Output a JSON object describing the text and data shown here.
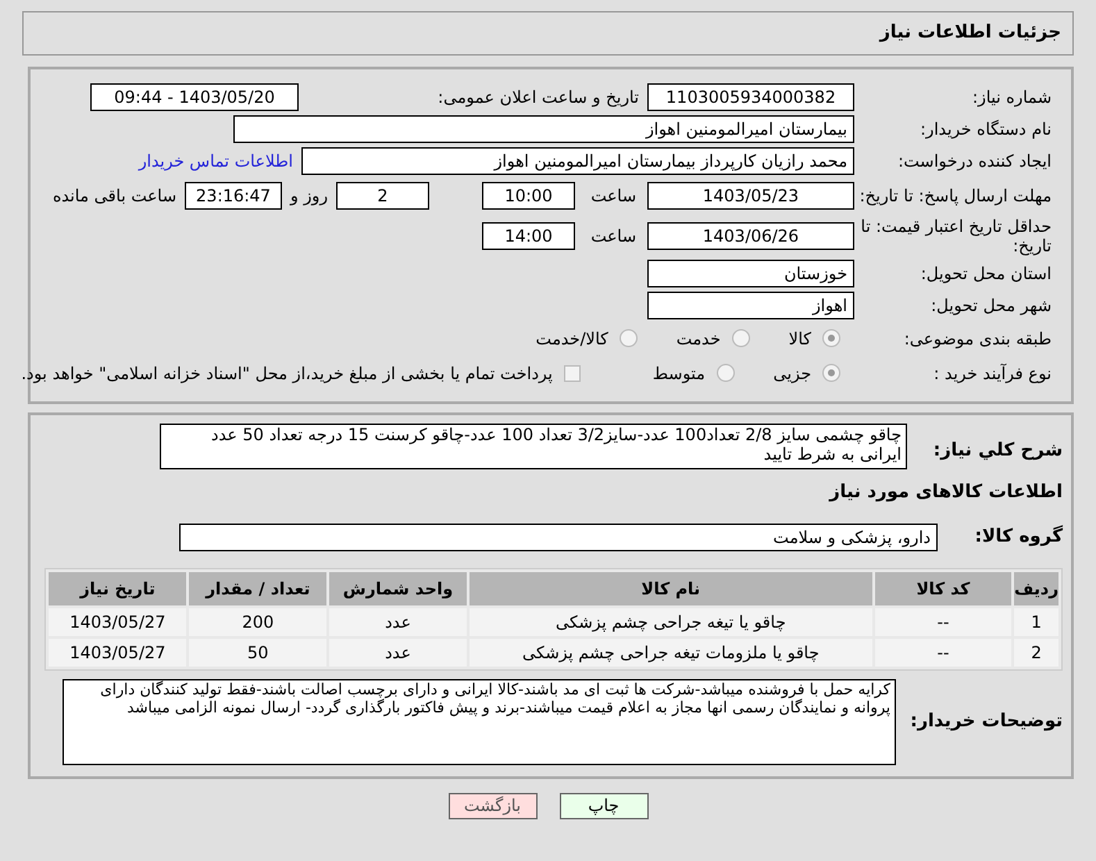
{
  "title": "جزئیات اطلاعات نیاز",
  "need_number": {
    "label": "شماره نیاز:",
    "value": "1103005934000382"
  },
  "announce": {
    "label": "تاریخ و ساعت اعلان عمومی:",
    "value": "1403/05/20 - 09:44"
  },
  "buyer_org": {
    "label": "نام دستگاه خریدار:",
    "value": "بیمارستان امیرالمومنین اهواز"
  },
  "requester": {
    "label": "ایجاد کننده درخواست:",
    "value": "محمد رازیان کارپرداز بیمارستان امیرالمومنین اهواز",
    "link": "اطلاعات تماس خریدار"
  },
  "reply_deadline": {
    "label": "مهلت ارسال پاسخ: تا تاریخ:",
    "date": "1403/05/23",
    "time_label": "ساعت",
    "time": "10:00",
    "days": "2",
    "days_label": "روز و",
    "remaining": "23:16:47",
    "remaining_label": "ساعت باقی مانده"
  },
  "price_validity": {
    "label": "حداقل تاریخ اعتبار قیمت: تا تاریخ:",
    "date": "1403/06/26",
    "time_label": "ساعت",
    "time": "14:00"
  },
  "province": {
    "label": "استان محل تحویل:",
    "value": "خوزستان"
  },
  "city": {
    "label": "شهر محل تحویل:",
    "value": "اهواز"
  },
  "category": {
    "label": "طبقه بندی موضوعی:",
    "options": [
      {
        "label": "کالا",
        "selected": true
      },
      {
        "label": "خدمت",
        "selected": false
      },
      {
        "label": "کالا/خدمت",
        "selected": false
      }
    ]
  },
  "process": {
    "label": "نوع فرآیند خرید :",
    "options": [
      {
        "label": "جزیی",
        "selected": true
      },
      {
        "label": "متوسط",
        "selected": false
      }
    ],
    "checkbox": {
      "label": "پرداخت تمام یا بخشی از مبلغ خرید،از محل \"اسناد خزانه اسلامی\" خواهد بود.",
      "checked": false
    }
  },
  "description": {
    "label": "شرح کلي نياز:",
    "value": "چاقو چشمی  سایز 2/8 تعداد100 عدد-سایز3/2 تعداد 100 عدد-چاقو کرسنت 15 درجه تعداد 50 عدد ایرانی به شرط تایید"
  },
  "goods_title": "اطلاعات کالاهای مورد نیاز",
  "goods_group": {
    "label": "گروه کالا:",
    "value": "دارو، پزشکی و سلامت"
  },
  "table": {
    "columns": [
      "ردیف",
      "کد کالا",
      "نام کالا",
      "واحد شمارش",
      "تعداد / مقدار",
      "تاریخ نیاز"
    ],
    "rows": [
      [
        "1",
        "--",
        "چاقو یا تیغه جراحی چشم پزشکی",
        "عدد",
        "200",
        "1403/05/27"
      ],
      [
        "2",
        "--",
        "چاقو یا ملزومات تیغه جراحی چشم پزشکی",
        "عدد",
        "50",
        "1403/05/27"
      ]
    ]
  },
  "buyer_notes": {
    "label": "توضیحات خریدار:",
    "value": "کرایه حمل با فروشنده میباشد-شرکت ها ثبت ای مد باشند-کالا ایرانی و دارای برچسب اصالت باشند-فقط تولید کنندگان دارای پروانه و نمایندگان رسمی انها مجاز به اعلام قیمت میباشند-برند و پیش فاکتور بارگذاری گردد- ارسال نمونه الزامی میباشد"
  },
  "buttons": [
    {
      "label": "چاپ",
      "kind": "print"
    },
    {
      "label": "بازگشت",
      "kind": "back"
    }
  ]
}
